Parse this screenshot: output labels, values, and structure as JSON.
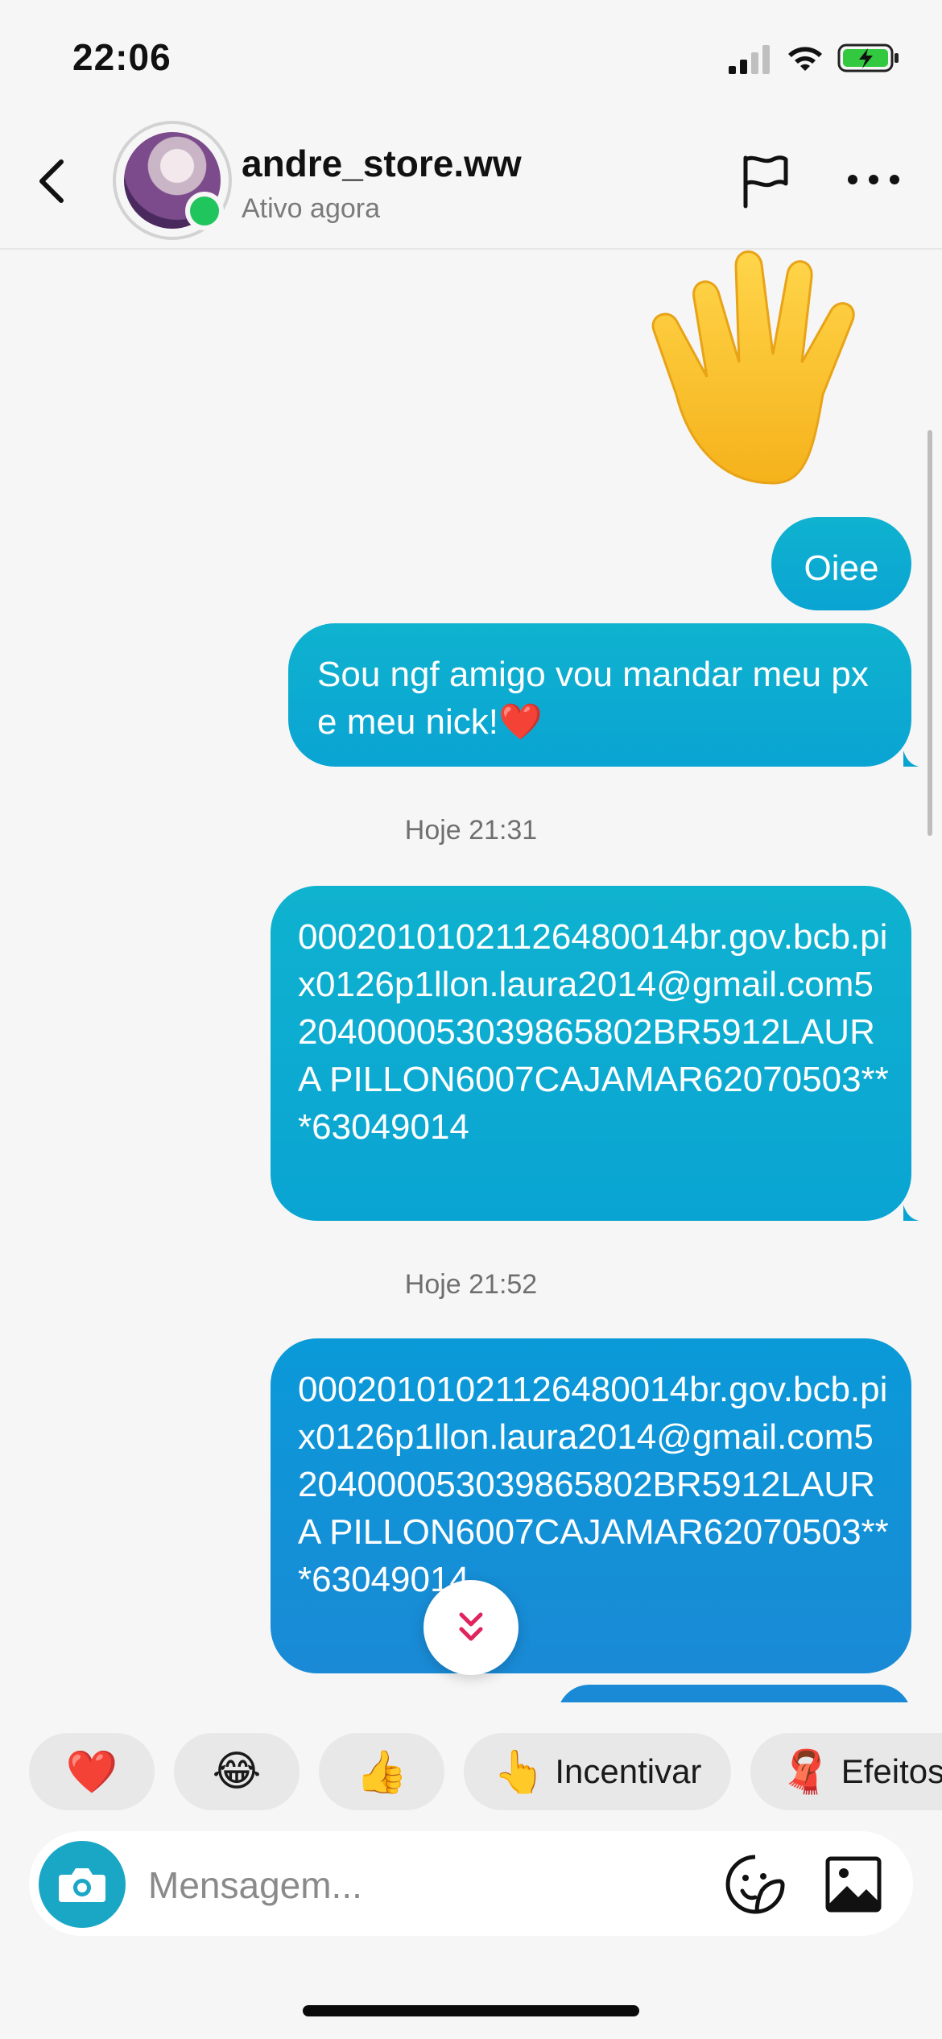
{
  "status_bar": {
    "time": "22:06"
  },
  "header": {
    "username": "andre_store.ww",
    "status": "Ativo agora"
  },
  "messages": [
    {
      "type": "sticker",
      "icon": "waving-hand-emoji"
    },
    {
      "type": "text",
      "text": "Oiee"
    },
    {
      "type": "text",
      "text": "Sou ngf amigo vou mandar meu px e meu nick!❤️"
    },
    {
      "type": "timestamp",
      "text": "Hoje 21:31"
    },
    {
      "type": "text",
      "text": "00020101021126480014br.gov.bcb.pix0126p1llon.laura2014@gmail.com5204000053039865802BR5912LAURA PILLON6007CAJAMAR62070503***63049014"
    },
    {
      "type": "timestamp",
      "text": "Hoje 21:52"
    },
    {
      "type": "text",
      "text": "00020101021126480014br.gov.bcb.pix0126p1llon.laura2014@gmail.com5204000053039865802BR5912LAURA PILLON6007CAJAMAR62070503***63049014"
    }
  ],
  "quick_reactions": [
    {
      "emoji": "❤️",
      "label": ""
    },
    {
      "emoji": "😂",
      "label": ""
    },
    {
      "emoji": "👍",
      "label": ""
    },
    {
      "emoji": "👆",
      "label": "Incentivar"
    },
    {
      "emoji": "🧣",
      "label": "Efeitos"
    }
  ],
  "composer": {
    "placeholder": "Mensagem..."
  },
  "colors": {
    "bubble_start": "#0fb2cf",
    "bubble_end": "#1a8ad6",
    "online": "#21c55d",
    "camera_button": "#1aa7c6",
    "battery": "#32c840"
  }
}
